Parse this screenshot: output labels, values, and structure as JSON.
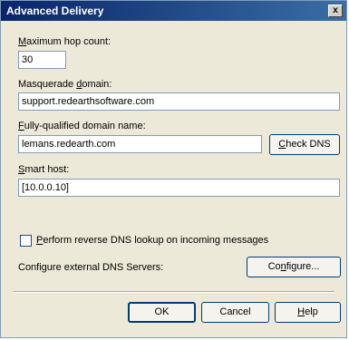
{
  "window": {
    "title": "Advanced Delivery",
    "close_glyph": "x"
  },
  "max_hop": {
    "label_accel": "M",
    "label_rest": "aximum hop count:",
    "value": "30"
  },
  "masquerade": {
    "label_pre": "Masquerade ",
    "label_accel": "d",
    "label_rest": "omain:",
    "value": "support.redearthsoftware.com"
  },
  "fqdn": {
    "label_accel": "F",
    "label_rest": "ully-qualified domain name:",
    "value": "lemans.redearth.com",
    "check_button_accel": "C",
    "check_button_rest": "heck DNS"
  },
  "smart_host": {
    "label_accel": "S",
    "label_rest": "mart host:",
    "value": "[10.0.0.10]"
  },
  "reverse_dns": {
    "label_accel": "P",
    "label_rest": "erform reverse DNS lookup on incoming messages",
    "checked": false
  },
  "external_dns": {
    "label": "Configure external DNS Servers:",
    "button_pre": "Co",
    "button_accel": "n",
    "button_rest": "figure..."
  },
  "footer": {
    "ok_label": "OK",
    "cancel_label": "Cancel",
    "help_accel": "H",
    "help_rest": "elp"
  }
}
